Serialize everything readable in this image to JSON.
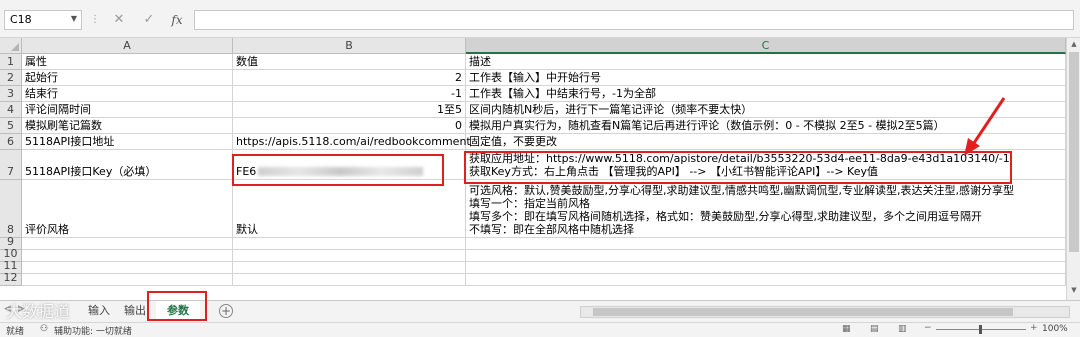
{
  "formula_bar": {
    "name_box": "C18",
    "cancel_icon": "✕",
    "enter_icon": "✓",
    "fx_label": "fx",
    "formula_value": ""
  },
  "columns": [
    "A",
    "B",
    "C"
  ],
  "rows": [
    {
      "num": "1",
      "a": "属性",
      "b": "数值",
      "c": [
        "描述"
      ]
    },
    {
      "num": "2",
      "a": "起始行",
      "b": "2",
      "c": [
        "工作表【输入】中开始行号"
      ]
    },
    {
      "num": "3",
      "a": "结束行",
      "b": "-1",
      "c": [
        "工作表【输入】中结束行号，-1为全部"
      ]
    },
    {
      "num": "4",
      "a": "评论间隔时间",
      "b": "1至5",
      "c": [
        "区间内随机N秒后，进行下一篇笔记评论（频率不要太快）"
      ]
    },
    {
      "num": "5",
      "a": "模拟刷笔记篇数",
      "b": "0",
      "c": [
        "模拟用户真实行为，随机查看N篇笔记后再进行评论（数值示例：0 - 不模拟 2至5 - 模拟2至5篇）"
      ]
    },
    {
      "num": "6",
      "a": "5118API接口地址",
      "b": "https://apis.5118.com/ai/redbookcomment",
      "c": [
        "固定值，不要更改"
      ]
    },
    {
      "num": "7",
      "a": "5118API接口Key（必填）",
      "b": "FE6",
      "c": [
        "获取应用地址：https://www.5118.com/apistore/detail/b3553220-53d4-ee11-8da9-e43d1a103140/-1",
        "获取Key方式：右上角点击 【管理我的API】 --> 【小红书智能评论API】--> Key值"
      ]
    },
    {
      "num": "8",
      "a": "评价风格",
      "b": "默认",
      "c": [
        "可选风格：默认,赞美鼓励型,分享心得型,求助建议型,情感共鸣型,幽默调侃型,专业解读型,表达关注型,感谢分享型",
        "填写一个：指定当前风格",
        "填写多个：即在填写风格间随机选择，格式如：赞美鼓励型,分享心得型,求助建议型，多个之间用逗号隔开",
        "不填写：即在全部风格中随机选择"
      ]
    },
    {
      "num": "9",
      "a": "",
      "b": "",
      "c": [
        ""
      ]
    },
    {
      "num": "10",
      "a": "",
      "b": "",
      "c": [
        ""
      ]
    },
    {
      "num": "11",
      "a": "",
      "b": "",
      "c": [
        ""
      ]
    },
    {
      "num": "12",
      "a": "",
      "b": "",
      "c": [
        ""
      ]
    }
  ],
  "tabs": [
    {
      "label": "输入"
    },
    {
      "label": "输出"
    },
    {
      "label": "参数"
    }
  ],
  "add_sheet_icon": "+",
  "status": {
    "ready": "就绪",
    "accessibility": "辅助功能: 一切就绪",
    "zoom": "100%"
  },
  "watermark": "大数据道",
  "colors": {
    "excel_green": "#217346",
    "highlight_red": "#e02020"
  }
}
